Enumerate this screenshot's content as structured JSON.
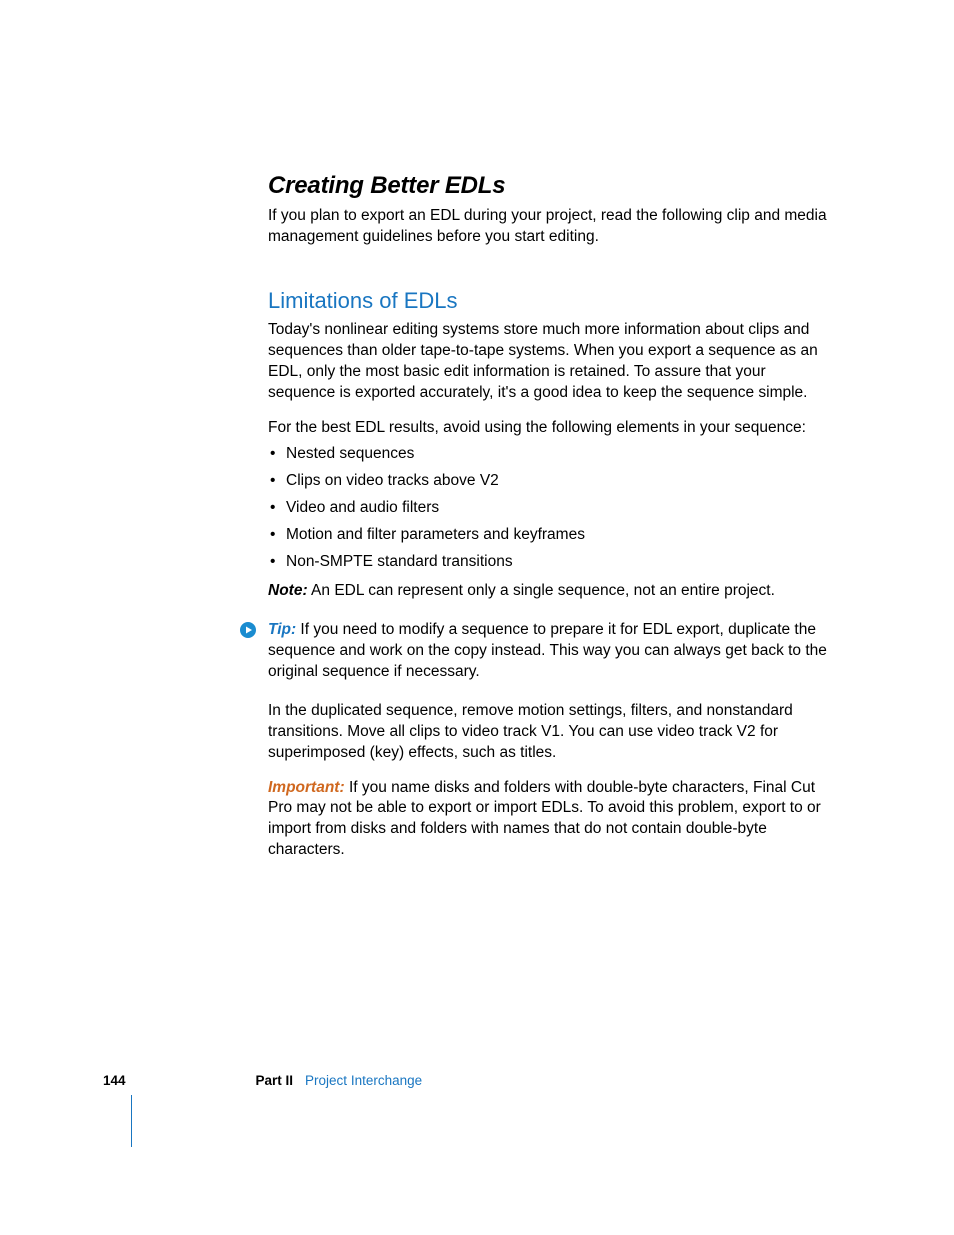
{
  "section": {
    "title": "Creating Better EDLs",
    "intro": "If you plan to export an EDL during your project, read the following clip and media management guidelines before you start editing."
  },
  "subsection": {
    "title": "Limitations of EDLs",
    "para1": "Today's nonlinear editing systems store much more information about clips and sequences than older tape-to-tape systems. When you export a sequence as an EDL, only the most basic edit information is retained. To assure that your sequence is exported accurately, it's a good idea to keep the sequence simple.",
    "avoidIntro": "For the best EDL results, avoid using the following elements in your sequence:",
    "bullets": [
      "Nested sequences",
      "Clips on video tracks above V2",
      "Video and audio filters",
      "Motion and filter parameters and keyframes",
      "Non-SMPTE standard transitions"
    ],
    "note": {
      "label": "Note:",
      "text": "  An EDL can represent only a single sequence, not an entire project."
    },
    "tip": {
      "label": "Tip:",
      "text": "  If you need to modify a sequence to prepare it for EDL export, duplicate the sequence and work on the copy instead. This way you can always get back to the original sequence if necessary."
    },
    "afterTip": "In the duplicated sequence, remove motion settings, filters, and nonstandard transitions. Move all clips to video track V1. You can use video track V2 for superimposed (key) effects, such as titles.",
    "important": {
      "label": "Important:",
      "text": "  If you name disks and folders with double-byte characters, Final Cut Pro may not be able to export or import EDLs. To avoid this problem, export to or import from disks and folders with names that do not contain double-byte characters."
    }
  },
  "footer": {
    "pageNumber": "144",
    "partLabel": "Part II",
    "partTitle": "Project Interchange"
  }
}
